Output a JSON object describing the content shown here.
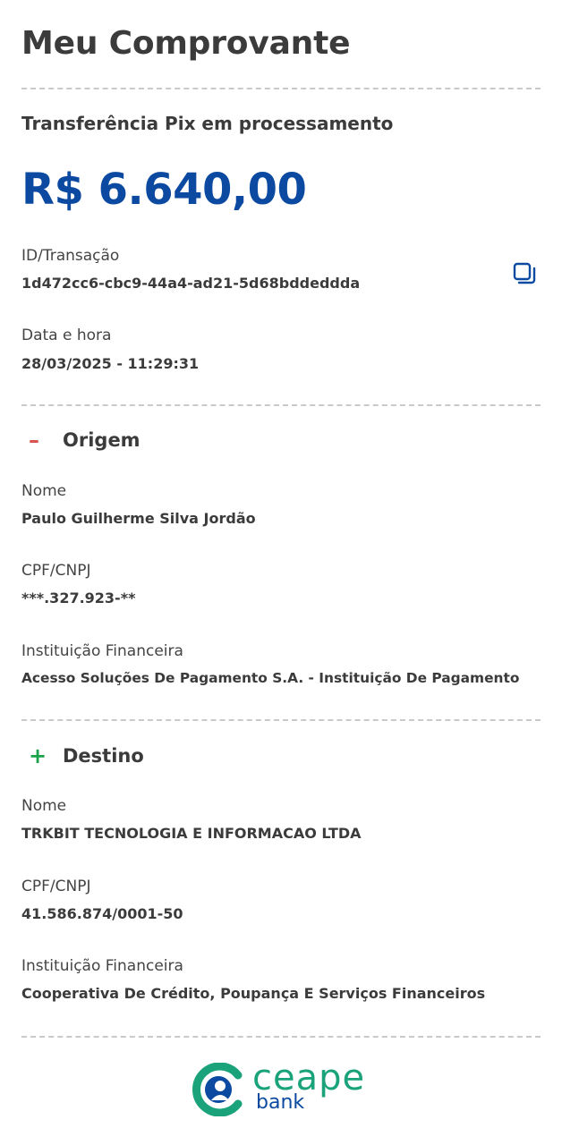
{
  "header": {
    "title": "Meu Comprovante"
  },
  "transfer": {
    "status": "Transferência Pix em processamento",
    "amount": "R$ 6.640,00"
  },
  "transaction": {
    "id_label": "ID/Transação",
    "id_value": "1d472cc6-cbc9-44a4-ad21-5d68bddeddda",
    "datetime_label": "Data e hora",
    "datetime_value": "28/03/2025 - 11:29:31"
  },
  "origin": {
    "sign": "–",
    "title": "Origem",
    "name_label": "Nome",
    "name_value": "Paulo Guilherme Silva Jordão",
    "doc_label": "CPF/CNPJ",
    "doc_value": "***.327.923-**",
    "bank_label": "Instituição Financeira",
    "bank_value": "Acesso Soluções De Pagamento S.A. - Instituição De Pagamento"
  },
  "destination": {
    "sign": "+",
    "title": "Destino",
    "name_label": "Nome",
    "name_value": "TRKBIT TECNOLOGIA E INFORMACAO LTDA",
    "doc_label": "CPF/CNPJ",
    "doc_value": "41.586.874/0001-50",
    "bank_label": "Instituição Financeira",
    "bank_value": "Cooperativa De Crédito, Poupança E Serviços Financeiros"
  },
  "footer": {
    "logo_word": "ceape",
    "logo_sub": "bank"
  },
  "icons": {
    "copy": "copy-icon",
    "collapse": "minus-icon",
    "expand": "plus-icon"
  },
  "colors": {
    "amount": "#0b4aa0",
    "minus": "#d9534f",
    "plus": "#1aa34a",
    "logo_green": "#1aa37a",
    "logo_blue": "#0b4aa0"
  }
}
